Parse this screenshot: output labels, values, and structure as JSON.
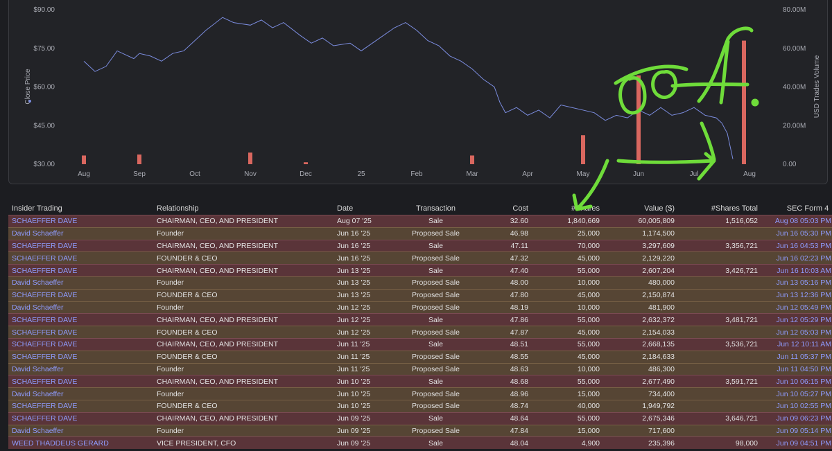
{
  "chart_data": {
    "type": "line",
    "ylabel_left": "Close Price",
    "ylabel_right": "USD Trades Volume",
    "y_left_ticks": [
      "$90.00",
      "$75.00",
      "$60.00",
      "$45.00",
      "$30.00"
    ],
    "y_right_ticks": [
      "80.00M",
      "60.00M",
      "40.00M",
      "20.00M",
      "0.00"
    ],
    "ylim_left": [
      30,
      90
    ],
    "ylim_right": [
      0,
      80
    ],
    "x_ticks": [
      "Aug",
      "Sep",
      "Oct",
      "Nov",
      "Dec",
      "25",
      "Feb",
      "Mar",
      "Apr",
      "May",
      "Jun",
      "Jul",
      "Aug"
    ],
    "series": [
      {
        "name": "Close Price",
        "color": "#7b8cde",
        "values": [
          [
            0,
            70
          ],
          [
            0.2,
            66
          ],
          [
            0.4,
            68
          ],
          [
            0.6,
            74
          ],
          [
            0.9,
            71
          ],
          [
            1.0,
            73
          ],
          [
            1.2,
            72
          ],
          [
            1.4,
            70
          ],
          [
            1.6,
            73
          ],
          [
            1.8,
            74
          ],
          [
            2.0,
            78
          ],
          [
            2.2,
            82
          ],
          [
            2.5,
            87
          ],
          [
            2.7,
            85
          ],
          [
            3.0,
            84
          ],
          [
            3.2,
            86
          ],
          [
            3.4,
            83
          ],
          [
            3.6,
            85
          ],
          [
            3.9,
            80
          ],
          [
            4.1,
            77
          ],
          [
            4.3,
            79
          ],
          [
            4.5,
            76
          ],
          [
            4.8,
            77
          ],
          [
            5.0,
            74
          ],
          [
            5.2,
            77
          ],
          [
            5.4,
            80
          ],
          [
            5.6,
            83
          ],
          [
            5.8,
            85
          ],
          [
            6.0,
            82
          ],
          [
            6.2,
            78
          ],
          [
            6.4,
            76
          ],
          [
            6.6,
            72
          ],
          [
            6.8,
            70
          ],
          [
            7.0,
            67
          ],
          [
            7.2,
            63
          ],
          [
            7.4,
            60
          ],
          [
            7.5,
            54
          ],
          [
            7.6,
            50
          ],
          [
            7.8,
            52
          ],
          [
            8.0,
            49
          ],
          [
            8.2,
            51
          ],
          [
            8.4,
            48
          ],
          [
            8.6,
            53
          ],
          [
            8.8,
            52
          ],
          [
            9.0,
            51
          ],
          [
            9.2,
            50
          ],
          [
            9.4,
            47
          ],
          [
            9.6,
            49
          ],
          [
            9.8,
            48
          ],
          [
            10.0,
            51
          ],
          [
            10.2,
            49
          ],
          [
            10.4,
            52
          ],
          [
            10.6,
            49
          ],
          [
            10.8,
            50
          ],
          [
            11.0,
            52
          ],
          [
            11.2,
            49
          ],
          [
            11.4,
            48
          ],
          [
            11.5,
            46
          ],
          [
            11.6,
            42
          ],
          [
            11.7,
            32
          ]
        ]
      },
      {
        "name": "USD Trades Volume",
        "color": "#d9675f",
        "type": "bar",
        "values": [
          [
            0.0,
            4.5
          ],
          [
            1.0,
            5
          ],
          [
            3.0,
            6
          ],
          [
            4.0,
            1
          ],
          [
            7.0,
            4.5
          ],
          [
            9.0,
            15
          ],
          [
            10.0,
            46
          ],
          [
            11.9,
            64
          ]
        ]
      }
    ],
    "grid": false,
    "legend": "none"
  },
  "table": {
    "headers": [
      "Insider Trading",
      "Relationship",
      "Date",
      "Transaction",
      "Cost",
      "#Shares",
      "Value ($)",
      "#Shares Total",
      "SEC Form 4"
    ],
    "rows": [
      {
        "name": "SCHAEFFER DAVE",
        "rel": "CHAIRMAN, CEO, AND PRESIDENT",
        "date": "Aug 07 '25",
        "tx": "Sale",
        "cost": "32.60",
        "shares": "1,840,669",
        "value": "60,005,809",
        "total": "1,516,052",
        "sec": "Aug 08 05:03 PM",
        "kind": "sale"
      },
      {
        "name": "David Schaeffer",
        "rel": "Founder",
        "date": "Jun 16 '25",
        "tx": "Proposed Sale",
        "cost": "46.98",
        "shares": "25,000",
        "value": "1,174,500",
        "total": "",
        "sec": "Jun 16 05:30 PM",
        "kind": "proposed"
      },
      {
        "name": "SCHAEFFER DAVE",
        "rel": "CHAIRMAN, CEO, AND PRESIDENT",
        "date": "Jun 16 '25",
        "tx": "Sale",
        "cost": "47.11",
        "shares": "70,000",
        "value": "3,297,609",
        "total": "3,356,721",
        "sec": "Jun 16 04:53 PM",
        "kind": "sale"
      },
      {
        "name": "SCHAEFFER DAVE",
        "rel": "FOUNDER & CEO",
        "date": "Jun 16 '25",
        "tx": "Proposed Sale",
        "cost": "47.32",
        "shares": "45,000",
        "value": "2,129,220",
        "total": "",
        "sec": "Jun 16 02:23 PM",
        "kind": "proposed"
      },
      {
        "name": "SCHAEFFER DAVE",
        "rel": "CHAIRMAN, CEO, AND PRESIDENT",
        "date": "Jun 13 '25",
        "tx": "Sale",
        "cost": "47.40",
        "shares": "55,000",
        "value": "2,607,204",
        "total": "3,426,721",
        "sec": "Jun 16 10:03 AM",
        "kind": "sale"
      },
      {
        "name": "David Schaeffer",
        "rel": "Founder",
        "date": "Jun 13 '25",
        "tx": "Proposed Sale",
        "cost": "48.00",
        "shares": "10,000",
        "value": "480,000",
        "total": "",
        "sec": "Jun 13 05:16 PM",
        "kind": "proposed"
      },
      {
        "name": "SCHAEFFER DAVE",
        "rel": "FOUNDER & CEO",
        "date": "Jun 13 '25",
        "tx": "Proposed Sale",
        "cost": "47.80",
        "shares": "45,000",
        "value": "2,150,874",
        "total": "",
        "sec": "Jun 13 12:36 PM",
        "kind": "proposed"
      },
      {
        "name": "David Schaeffer",
        "rel": "Founder",
        "date": "Jun 12 '25",
        "tx": "Proposed Sale",
        "cost": "48.19",
        "shares": "10,000",
        "value": "481,900",
        "total": "",
        "sec": "Jun 12 05:49 PM",
        "kind": "proposed"
      },
      {
        "name": "SCHAEFFER DAVE",
        "rel": "CHAIRMAN, CEO, AND PRESIDENT",
        "date": "Jun 12 '25",
        "tx": "Sale",
        "cost": "47.86",
        "shares": "55,000",
        "value": "2,632,372",
        "total": "3,481,721",
        "sec": "Jun 12 05:29 PM",
        "kind": "sale"
      },
      {
        "name": "SCHAEFFER DAVE",
        "rel": "FOUNDER & CEO",
        "date": "Jun 12 '25",
        "tx": "Proposed Sale",
        "cost": "47.87",
        "shares": "45,000",
        "value": "2,154,033",
        "total": "",
        "sec": "Jun 12 05:03 PM",
        "kind": "proposed"
      },
      {
        "name": "SCHAEFFER DAVE",
        "rel": "CHAIRMAN, CEO, AND PRESIDENT",
        "date": "Jun 11 '25",
        "tx": "Sale",
        "cost": "48.51",
        "shares": "55,000",
        "value": "2,668,135",
        "total": "3,536,721",
        "sec": "Jun 12 10:11 AM",
        "kind": "sale"
      },
      {
        "name": "SCHAEFFER DAVE",
        "rel": "FOUNDER & CEO",
        "date": "Jun 11 '25",
        "tx": "Proposed Sale",
        "cost": "48.55",
        "shares": "45,000",
        "value": "2,184,633",
        "total": "",
        "sec": "Jun 11 05:37 PM",
        "kind": "proposed"
      },
      {
        "name": "David Schaeffer",
        "rel": "Founder",
        "date": "Jun 11 '25",
        "tx": "Proposed Sale",
        "cost": "48.63",
        "shares": "10,000",
        "value": "486,300",
        "total": "",
        "sec": "Jun 11 04:50 PM",
        "kind": "proposed"
      },
      {
        "name": "SCHAEFFER DAVE",
        "rel": "CHAIRMAN, CEO, AND PRESIDENT",
        "date": "Jun 10 '25",
        "tx": "Sale",
        "cost": "48.68",
        "shares": "55,000",
        "value": "2,677,490",
        "total": "3,591,721",
        "sec": "Jun 10 06:15 PM",
        "kind": "sale"
      },
      {
        "name": "David Schaeffer",
        "rel": "Founder",
        "date": "Jun 10 '25",
        "tx": "Proposed Sale",
        "cost": "48.96",
        "shares": "15,000",
        "value": "734,400",
        "total": "",
        "sec": "Jun 10 05:27 PM",
        "kind": "proposed"
      },
      {
        "name": "SCHAEFFER DAVE",
        "rel": "FOUNDER & CEO",
        "date": "Jun 10 '25",
        "tx": "Proposed Sale",
        "cost": "48.74",
        "shares": "40,000",
        "value": "1,949,792",
        "total": "",
        "sec": "Jun 10 02:55 PM",
        "kind": "proposed"
      },
      {
        "name": "SCHAEFFER DAVE",
        "rel": "CHAIRMAN, CEO, AND PRESIDENT",
        "date": "Jun 09 '25",
        "tx": "Sale",
        "cost": "48.64",
        "shares": "55,000",
        "value": "2,675,346",
        "total": "3,646,721",
        "sec": "Jun 09 06:23 PM",
        "kind": "sale"
      },
      {
        "name": "David Schaeffer",
        "rel": "Founder",
        "date": "Jun 09 '25",
        "tx": "Proposed Sale",
        "cost": "47.84",
        "shares": "15,000",
        "value": "717,600",
        "total": "",
        "sec": "Jun 09 05:14 PM",
        "kind": "proposed"
      },
      {
        "name": "WEED THADDEUS GERARD",
        "rel": "VICE PRESIDENT, CFO",
        "date": "Jun 09 '25",
        "tx": "Sale",
        "cost": "48.04",
        "shares": "4,900",
        "value": "235,396",
        "total": "98,000",
        "sec": "Jun 09 04:51 PM",
        "kind": "sale"
      }
    ]
  },
  "annotation": {
    "text": "oof.",
    "color": "#6fdc3a"
  }
}
